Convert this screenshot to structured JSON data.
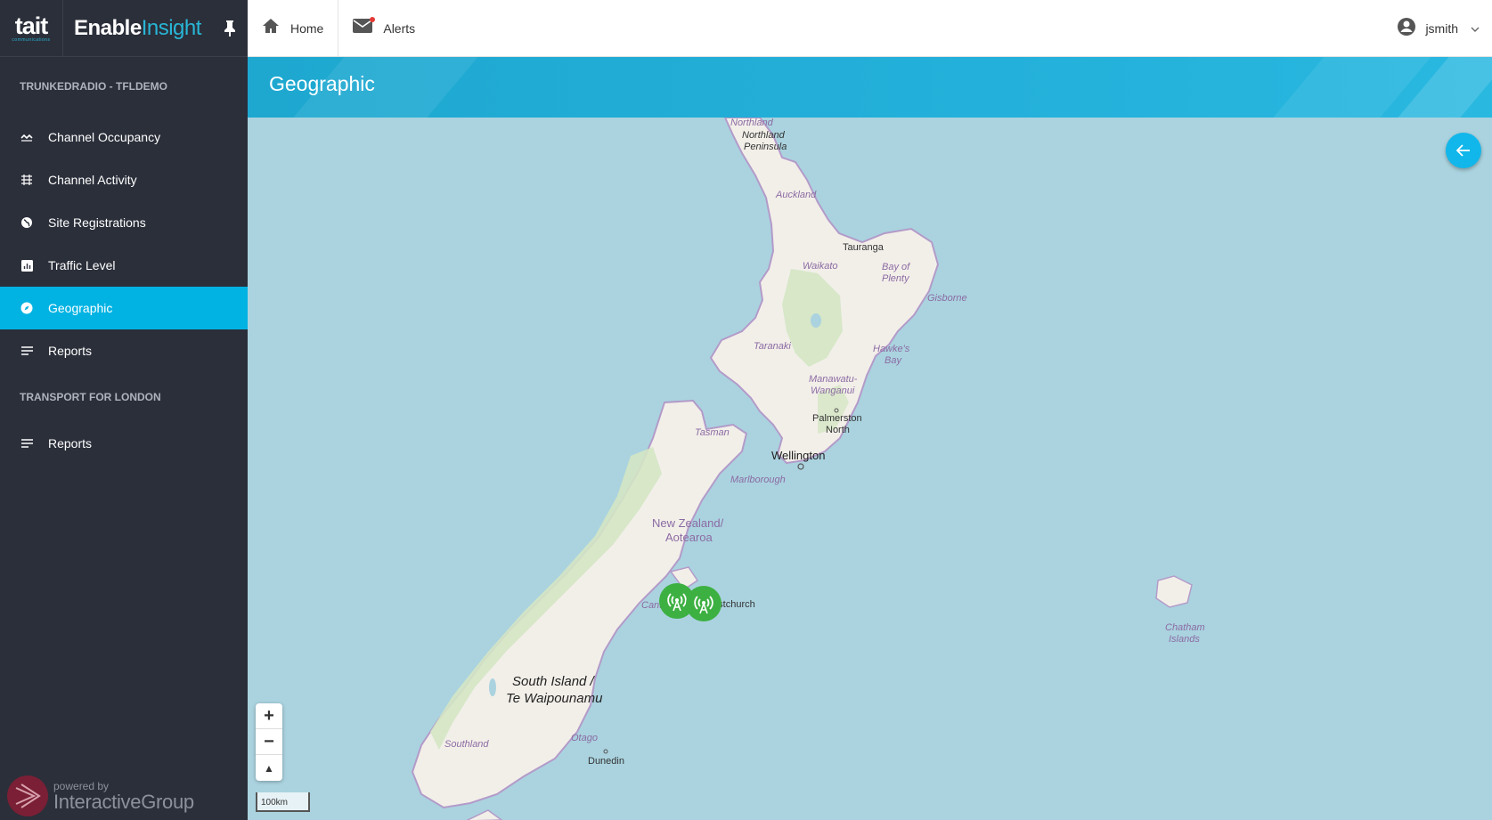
{
  "brand": {
    "company": "tait",
    "company_tagline": "communications",
    "app_name_1": "Enable",
    "app_name_2": "Insight"
  },
  "sidebar": {
    "section1_title": "TRUNKEDRADIO - TFLDEMO",
    "section1_items": [
      {
        "label": "Channel Occupancy",
        "icon": "occupancy-icon"
      },
      {
        "label": "Channel Activity",
        "icon": "activity-icon"
      },
      {
        "label": "Site Registrations",
        "icon": "globe-icon"
      },
      {
        "label": "Traffic Level",
        "icon": "bar-chart-icon"
      },
      {
        "label": "Geographic",
        "icon": "compass-icon",
        "active": true
      },
      {
        "label": "Reports",
        "icon": "list-icon"
      }
    ],
    "section2_title": "TRANSPORT FOR LONDON",
    "section2_items": [
      {
        "label": "Reports",
        "icon": "list-icon"
      }
    ],
    "powered_by": "powered by",
    "powered_company": "InteractiveGroup"
  },
  "topbar": {
    "home_label": "Home",
    "alerts_label": "Alerts",
    "user_name": "jsmith"
  },
  "page": {
    "title": "Geographic"
  },
  "map": {
    "labels": {
      "northland": "Northland",
      "northland_peninsula_1": "Northland",
      "northland_peninsula_2": "Peninsula",
      "auckland": "Auckland",
      "tauranga": "Tauranga",
      "waikato": "Waikato",
      "bay_of_plenty_1": "Bay of",
      "bay_of_plenty_2": "Plenty",
      "gisborne": "Gisborne",
      "taranaki": "Taranaki",
      "hawkes_bay_1": "Hawke's",
      "hawkes_bay_2": "Bay",
      "manawatu_1": "Manawatu-",
      "manawatu_2": "Wanganui",
      "palmerston_1": "Palmerston",
      "palmerston_2": "North",
      "tasman": "Tasman",
      "wellington": "Wellington",
      "marlborough": "Marlborough",
      "nz_1": "New Zealand/",
      "nz_2": "Aotearoa",
      "christchurch": "Christchurch",
      "canterbury": "Canterbury",
      "chatham_1": "Chatham",
      "chatham_2": "Islands",
      "south_island_1": "South Island /",
      "south_island_2": "Te Waipounamu",
      "otago": "Otago",
      "southland": "Southland",
      "dunedin": "Dunedin"
    },
    "zoom_in": "+",
    "zoom_out": "−",
    "reset_north": "▲",
    "scale_label": "100km",
    "marker_count": 2
  }
}
